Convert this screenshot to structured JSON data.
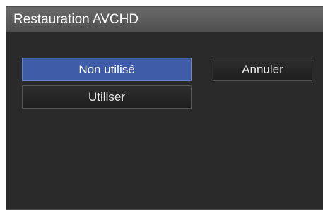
{
  "dialog": {
    "title": "Restauration AVCHD"
  },
  "options": {
    "non_utilise_label": "Non utilisé",
    "utiliser_label": "Utiliser",
    "annuler_label": "Annuler"
  },
  "colors": {
    "selected_accent": "#3f5ca8",
    "dialog_background": "#2a2a2a",
    "title_bar": "#5c5c5c"
  }
}
